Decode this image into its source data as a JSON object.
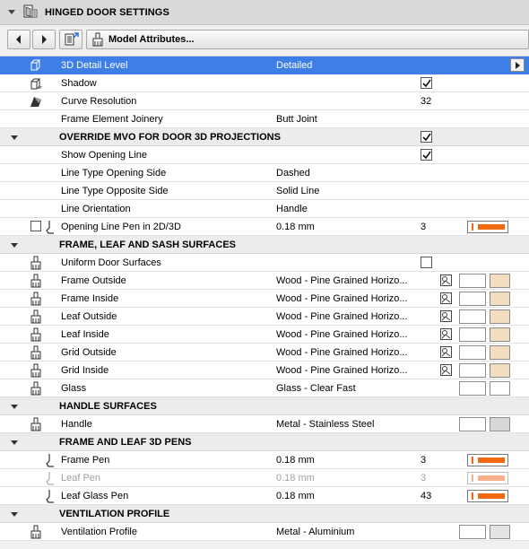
{
  "panel": {
    "title": "HINGED DOOR SETTINGS"
  },
  "toolbar": {
    "model_attributes_label": "Model Attributes..."
  },
  "colors": {
    "selection": "#3d7fe6",
    "pen_orange": "#f26a10",
    "pen_orange_disabled": "#f6b08a",
    "wood_swatch": "#f2ddc0",
    "metal_swatch": "#d8d8d8",
    "glass_swatch": "#ffffff"
  },
  "rows": {
    "r0": {
      "label": "3D Detail Level",
      "value": "Detailed"
    },
    "r1": {
      "label": "Shadow",
      "checked": true
    },
    "r2": {
      "label": "Curve Resolution",
      "value": "32"
    },
    "r3": {
      "label": "Frame Element Joinery",
      "value": "Butt Joint"
    },
    "r4": {
      "label": "OVERRIDE MVO FOR DOOR 3D PROJECTIONS",
      "checked": true
    },
    "r5": {
      "label": "Show Opening Line",
      "checked": true
    },
    "r6": {
      "label": "Line Type Opening Side",
      "value": "Dashed"
    },
    "r7": {
      "label": "Line Type Opposite Side",
      "value": "Solid Line"
    },
    "r8": {
      "label": "Line Orientation",
      "value": "Handle"
    },
    "r9": {
      "label": "Opening Line Pen in 2D/3D",
      "value": "0.18 mm",
      "num": "3"
    },
    "r10": {
      "label": "FRAME, LEAF AND SASH SURFACES"
    },
    "r11": {
      "label": "Uniform Door Surfaces",
      "checked": false
    },
    "r12": {
      "label": "Frame Outside",
      "value": "Wood - Pine Grained Horizo..."
    },
    "r13": {
      "label": "Frame Inside",
      "value": "Wood - Pine Grained Horizo..."
    },
    "r14": {
      "label": "Leaf Outside",
      "value": "Wood - Pine Grained Horizo..."
    },
    "r15": {
      "label": "Leaf Inside",
      "value": "Wood - Pine Grained Horizo..."
    },
    "r16": {
      "label": "Grid Outside",
      "value": "Wood - Pine Grained Horizo..."
    },
    "r17": {
      "label": "Grid Inside",
      "value": "Wood - Pine Grained Horizo..."
    },
    "r18": {
      "label": "Glass",
      "value": "Glass - Clear Fast"
    },
    "r19": {
      "label": "HANDLE SURFACES"
    },
    "r20": {
      "label": "Handle",
      "value": "Metal - Stainless Steel"
    },
    "r21": {
      "label": "FRAME AND LEAF 3D PENS"
    },
    "r22": {
      "label": "Frame Pen",
      "value": "0.18 mm",
      "num": "3"
    },
    "r23": {
      "label": "Leaf Pen",
      "value": "0.18 mm",
      "num": "3"
    },
    "r24": {
      "label": "Leaf Glass Pen",
      "value": "0.18 mm",
      "num": "43"
    },
    "r25": {
      "label": "VENTILATION PROFILE"
    },
    "r26": {
      "label": "Ventilation Profile",
      "value": "Metal - Aluminium"
    }
  }
}
